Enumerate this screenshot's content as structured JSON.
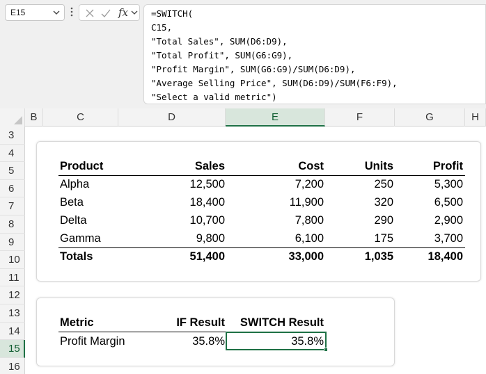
{
  "name_box": {
    "value": "E15"
  },
  "formula_bar": {
    "fx_label": "fx",
    "lines": [
      "=SWITCH(",
      "C15,",
      "\"Total Sales\", SUM(D6:D9),",
      "\"Total Profit\", SUM(G6:G9),",
      "\"Profit Margin\", SUM(G6:G9)/SUM(D6:D9),",
      "\"Average Selling Price\", SUM(D6:D9)/SUM(F6:F9),",
      "\"Select a valid metric\")"
    ]
  },
  "columns": [
    "B",
    "C",
    "D",
    "E",
    "F",
    "G",
    "H"
  ],
  "selected_column": "E",
  "rows": [
    "3",
    "4",
    "5",
    "6",
    "7",
    "8",
    "9",
    "10",
    "11",
    "12",
    "13",
    "14",
    "15",
    "16"
  ],
  "selected_row": "15",
  "table": {
    "headers": {
      "product": "Product",
      "sales": "Sales",
      "cost": "Cost",
      "units": "Units",
      "profit": "Profit"
    },
    "rows": [
      {
        "product": "Alpha",
        "sales": "12,500",
        "cost": "7,200",
        "units": "250",
        "profit": "5,300"
      },
      {
        "product": "Beta",
        "sales": "18,400",
        "cost": "11,900",
        "units": "320",
        "profit": "6,500"
      },
      {
        "product": "Delta",
        "sales": "10,700",
        "cost": "7,800",
        "units": "290",
        "profit": "2,900"
      },
      {
        "product": "Gamma",
        "sales": "9,800",
        "cost": "6,100",
        "units": "175",
        "profit": "3,700"
      }
    ],
    "totals": {
      "label": "Totals",
      "sales": "51,400",
      "cost": "33,000",
      "units": "1,035",
      "profit": "18,400"
    }
  },
  "metric_table": {
    "headers": {
      "metric": "Metric",
      "if_result": "IF Result",
      "switch_result": "SWITCH Result"
    },
    "row": {
      "metric": "Profit Margin",
      "if_result": "35.8%",
      "switch_result": "35.8%"
    }
  },
  "colors": {
    "selection_green": "#1e7145",
    "header_gray": "#f3f3f3",
    "formula_bg": "#f0f0f0"
  }
}
